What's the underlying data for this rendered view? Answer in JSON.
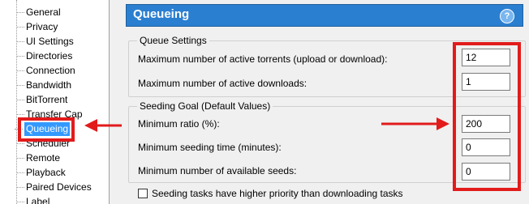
{
  "tree": {
    "items": [
      {
        "label": "General"
      },
      {
        "label": "Privacy"
      },
      {
        "label": "UI Settings"
      },
      {
        "label": "Directories"
      },
      {
        "label": "Connection"
      },
      {
        "label": "Bandwidth"
      },
      {
        "label": "BitTorrent"
      },
      {
        "label": "Transfer Cap"
      },
      {
        "label": "Queueing"
      },
      {
        "label": "Scheduler"
      },
      {
        "label": "Remote"
      },
      {
        "label": "Playback"
      },
      {
        "label": "Paired Devices"
      },
      {
        "label": "Label"
      }
    ],
    "selected_index": 8
  },
  "header": {
    "title": "Queueing",
    "help_icon": "question-mark"
  },
  "queue_settings": {
    "title": "Queue Settings",
    "max_active_torrents_label": "Maximum number of active torrents (upload or download):",
    "max_active_torrents_value": "12",
    "max_active_downloads_label": "Maximum number of active downloads:",
    "max_active_downloads_value": "1"
  },
  "seeding_goal": {
    "title": "Seeding Goal (Default Values)",
    "min_ratio_label": "Minimum ratio (%):",
    "min_ratio_value": "200",
    "min_seeding_time_label": "Minimum seeding time (minutes):",
    "min_seeding_time_value": "0",
    "min_seeds_label": "Minimum number of available seeds:",
    "min_seeds_value": "0"
  },
  "priority_checkbox": {
    "label": "Seeding tasks have higher priority than downloading tasks",
    "checked": false
  },
  "colors": {
    "accent": "#2b7fd0",
    "highlight": "#e21b1b",
    "selection": "#3399ff"
  }
}
